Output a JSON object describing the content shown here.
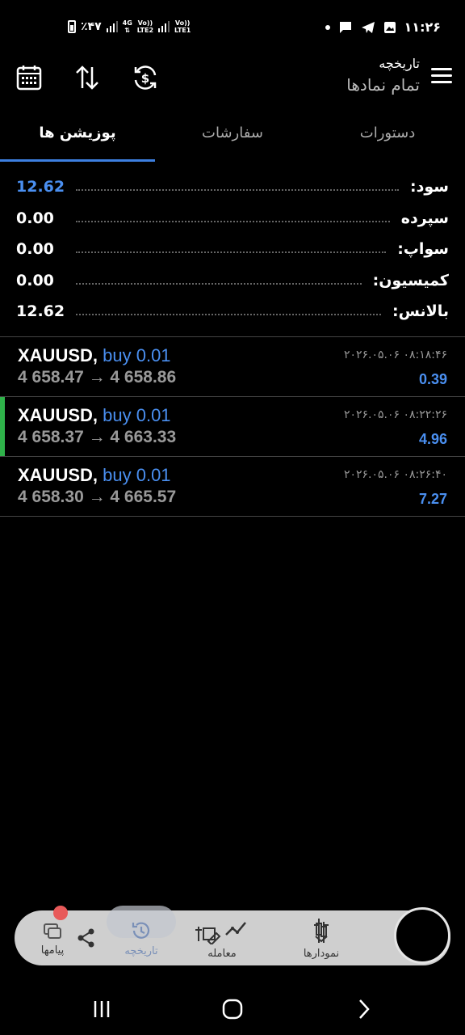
{
  "status_bar": {
    "time": "۱۱:۲۶",
    "battery_text": "٪۴۷",
    "net1_top": "4G",
    "net1_bottom": "LTE2",
    "volte1_top": "Vo))",
    "volte2_top": "Vo))",
    "net2_bottom": "LTE1"
  },
  "header": {
    "title": "تاریخچه",
    "subtitle": "تمام نمادها",
    "icons": [
      "calendar-icon",
      "sort-icon",
      "currency-refresh-icon",
      "hamburger-menu-icon"
    ]
  },
  "tabs": [
    {
      "label": "پوزیشن ها",
      "active": true
    },
    {
      "label": "سفارشات",
      "active": false
    },
    {
      "label": "دستورات",
      "active": false
    }
  ],
  "summary": [
    {
      "label": "سود:",
      "value": "12.62",
      "highlight": true
    },
    {
      "label": "سپرده",
      "value": "0.00",
      "highlight": false
    },
    {
      "label": "سواپ:",
      "value": "0.00",
      "highlight": false
    },
    {
      "label": "کمیسیون:",
      "value": "0.00",
      "highlight": false
    },
    {
      "label": "بالانس:",
      "value": "12.62",
      "highlight": false
    }
  ],
  "trades": [
    {
      "symbol": "XAUUSD,",
      "side": "buy 0.01",
      "prices": "4 658.47 → 4 658.86",
      "time": "۲۰۲۶.۰۵.۰۶ ۰۸:۱۸:۴۶",
      "profit": "0.39"
    },
    {
      "symbol": "XAUUSD,",
      "side": "buy 0.01",
      "prices": "4 658.37 → 4 663.33",
      "time": "۲۰۲۶.۰۵.۰۶ ۰۸:۲۲:۲۶",
      "profit": "4.96"
    },
    {
      "symbol": "XAUUSD,",
      "side": "buy 0.01",
      "prices": "4 658.30 → 4 665.57",
      "time": "۲۰۲۶.۰۵.۰۶ ۰۸:۲۶:۴۰",
      "profit": "7.27"
    }
  ],
  "bottom_nav": {
    "messages": "پیامها",
    "history": "تاریخچه",
    "trade": "معامله",
    "charts": "نمودارها"
  },
  "colors": {
    "accent": "#3d7fe0",
    "profit": "#4a8ff0",
    "marker": "#2fb24a"
  }
}
